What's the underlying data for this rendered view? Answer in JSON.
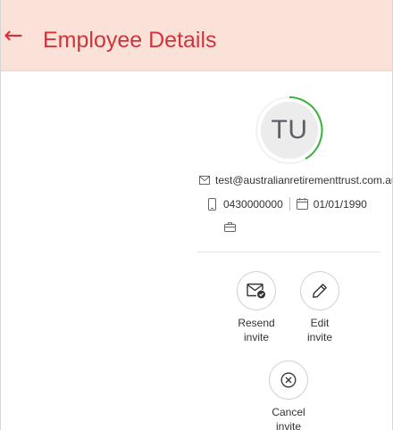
{
  "header": {
    "back_icon": "arrow-left-icon",
    "title": "Employee Details",
    "background_color": "#fbe2d9",
    "accent_color": "#d0343b"
  },
  "profile": {
    "initials": "TU",
    "progress_color": "#3bb33b",
    "email": "test@australianretirementtrust.com.au",
    "phone": "0430000000",
    "dob": "01/01/1990"
  },
  "actions": {
    "resend": {
      "line1": "Resend",
      "line2": "invite",
      "icon": "mail-check-icon"
    },
    "edit": {
      "line1": "Edit",
      "line2": "invite",
      "icon": "pencil-icon"
    },
    "cancel": {
      "line1": "Cancel",
      "line2": "invite",
      "icon": "circle-x-icon"
    }
  }
}
